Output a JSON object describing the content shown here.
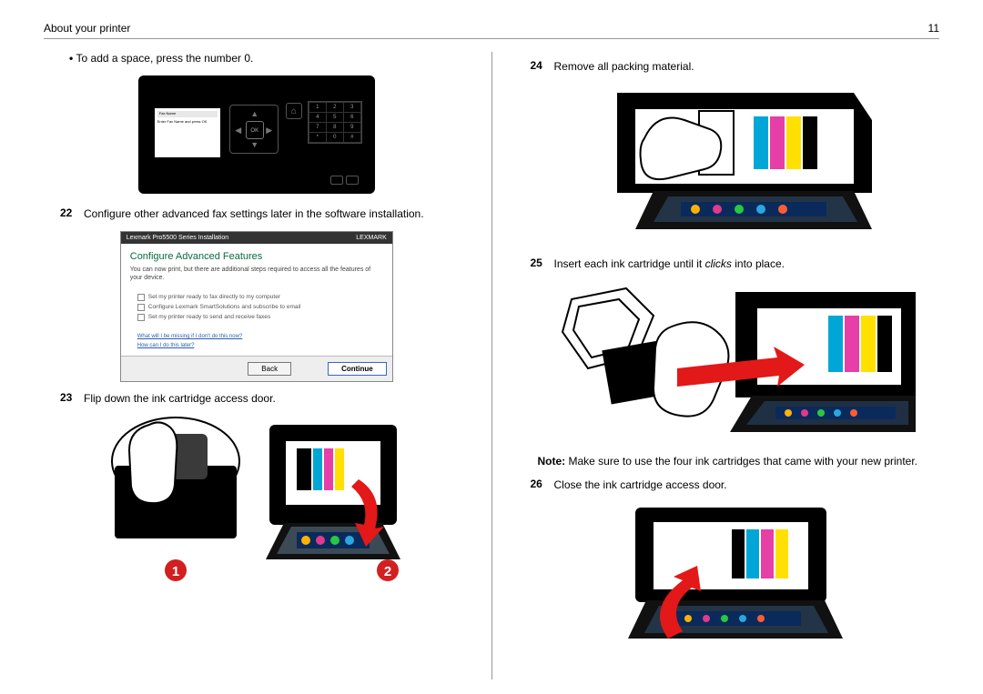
{
  "header": {
    "title": "About your printer",
    "page_number": "11"
  },
  "left": {
    "bullet": "To add a space, press the number 0.",
    "panel": {
      "screen_title": "Fax Name",
      "screen_hint": "Enter Fax Name and press OK",
      "ok_label": "OK",
      "keys": [
        "1",
        "2",
        "3",
        "4",
        "5",
        "6",
        "7",
        "8",
        "9",
        "*",
        "0",
        "#"
      ]
    },
    "step22": {
      "num": "22",
      "text": "Configure other advanced fax settings later in the software installation."
    },
    "dialog": {
      "titlebar_left": "Lexmark Pro5500 Series Installation",
      "brand": "LEXMARK",
      "heading": "Configure Advanced Features",
      "sub": "You can now print, but there are additional steps required to access all the features of your device.",
      "opt1": "Set my printer ready to fax directly to my computer",
      "opt2": "Configure Lexmark SmartSolutions and subscribe to email",
      "opt3": "Set my printer ready to send and receive faxes",
      "link1": "What will I be missing if I don't do this now?",
      "link2": "How can I do this later?",
      "btn_back": "Back",
      "btn_continue": "Continue"
    },
    "step23": {
      "num": "23",
      "text": "Flip down the ink cartridge access door."
    },
    "markers": {
      "one": "1",
      "two": "2"
    }
  },
  "right": {
    "step24": {
      "num": "24",
      "text": "Remove all packing material."
    },
    "step25": {
      "num": "25",
      "text_a": "Insert each ink cartridge until it ",
      "italic": "clicks",
      "text_b": " into place."
    },
    "note": {
      "label": "Note:",
      "text": " Make sure to use the four ink cartridges that came with your new printer."
    },
    "step26": {
      "num": "26",
      "text": "Close the ink cartridge access door."
    }
  }
}
